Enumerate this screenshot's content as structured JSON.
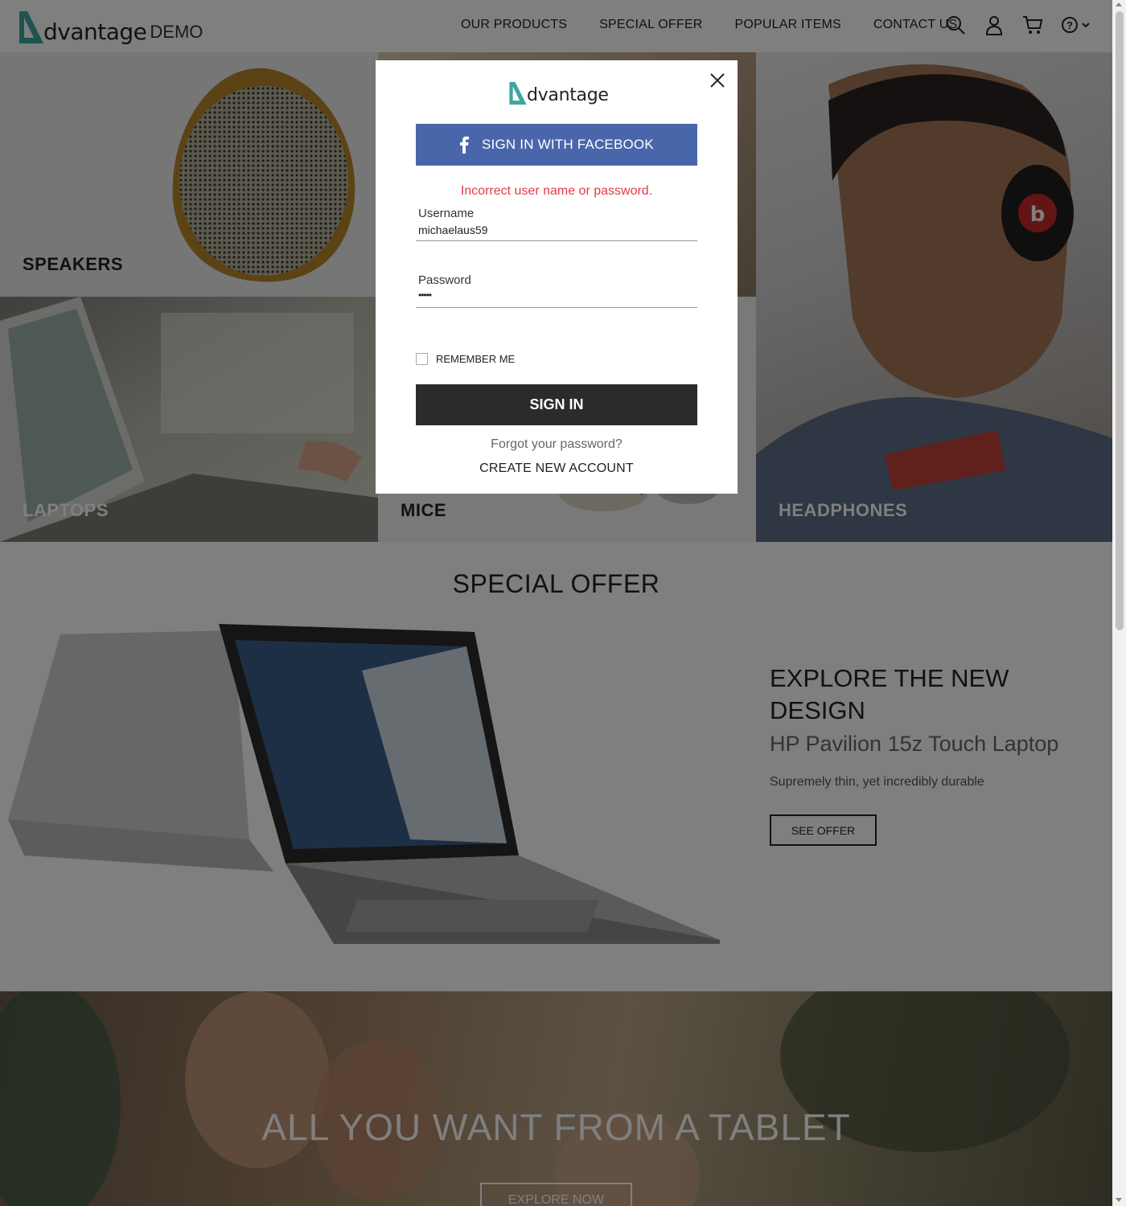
{
  "brand": {
    "logo_text": "dvantage",
    "logo_suffix": "DEMO",
    "accent_color": "#3aa7a0"
  },
  "nav": {
    "items": [
      {
        "label": "OUR PRODUCTS"
      },
      {
        "label": "SPECIAL OFFER"
      },
      {
        "label": "POPULAR ITEMS"
      },
      {
        "label": "CONTACT US"
      }
    ],
    "icons": [
      "search-icon",
      "user-icon",
      "cart-icon",
      "help-icon",
      "chevron-down-icon"
    ]
  },
  "categories": {
    "speakers": "SPEAKERS",
    "laptops": "LAPTOPS",
    "mice": "MICE",
    "headphones": "HEADPHONES"
  },
  "special_offer": {
    "section_title": "SPECIAL OFFER",
    "headline": "EXPLORE THE NEW DESIGN",
    "product": "HP Pavilion 15z Touch Laptop",
    "description": "Supremely thin, yet incredibly durable",
    "button": "SEE OFFER"
  },
  "banner": {
    "title": "ALL YOU WANT FROM A TABLET",
    "button": "EXPLORE NOW"
  },
  "login_modal": {
    "logo_text": "dvantage",
    "facebook_button": "SIGN IN WITH FACEBOOK",
    "facebook_color": "#4a66ab",
    "error_message": "Incorrect user name or password.",
    "error_color": "#e33b49",
    "username_label": "Username",
    "username_value": "michaelaus59",
    "password_label": "Password",
    "password_value": "•••••",
    "remember_me": "REMEMBER ME",
    "remember_checked": false,
    "sign_in_button": "SIGN IN",
    "forgot_password": "Forgot your password?",
    "create_account": "CREATE NEW ACCOUNT"
  }
}
